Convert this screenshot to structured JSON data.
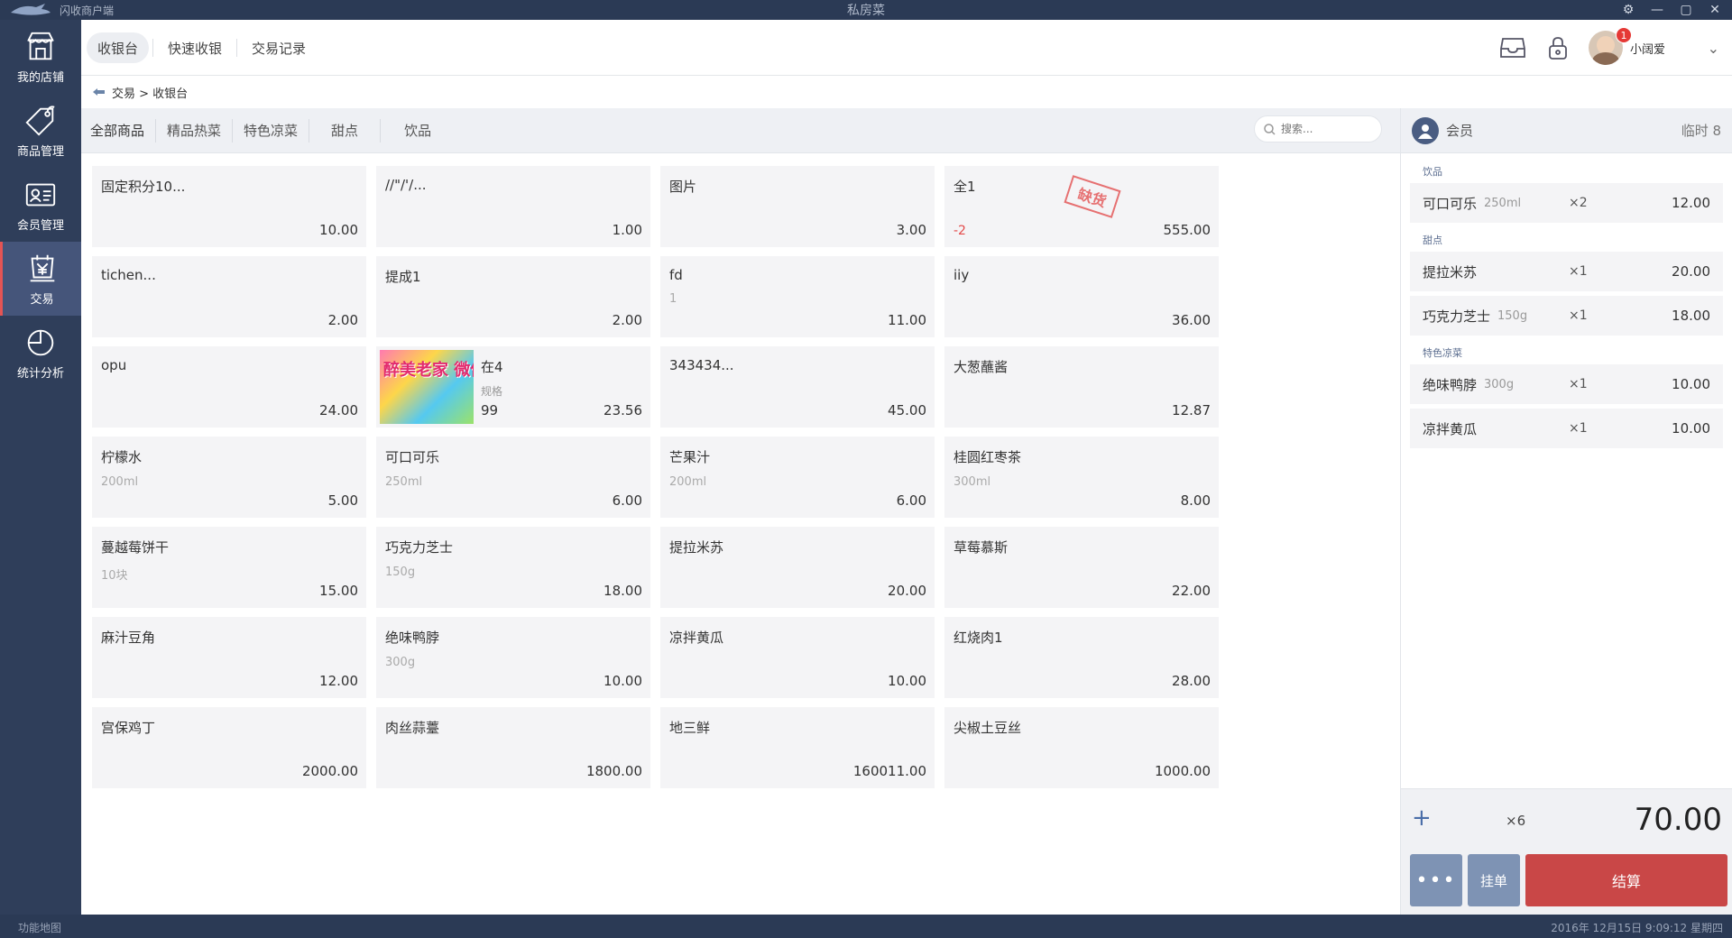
{
  "titlebar": {
    "app_name": "闪收商户端",
    "window_title": "私房菜",
    "icons": [
      "gear-icon",
      "minimize-icon",
      "maximize-icon",
      "close-icon"
    ]
  },
  "sidebar": {
    "items": [
      {
        "label": "我的店铺",
        "icon": "store-icon"
      },
      {
        "label": "商品管理",
        "icon": "tag-icon"
      },
      {
        "label": "会员管理",
        "icon": "member-card-icon"
      },
      {
        "label": "交易",
        "icon": "yen-bag-icon",
        "active": true
      },
      {
        "label": "统计分析",
        "icon": "pie-chart-icon"
      }
    ]
  },
  "toolbar": {
    "tabs": [
      {
        "label": "收银台",
        "active": true
      },
      {
        "label": "快速收银"
      },
      {
        "label": "交易记录"
      }
    ],
    "user": {
      "name": "小阔爱",
      "badge": "1"
    }
  },
  "breadcrumb": {
    "path": "交易 > 收银台"
  },
  "categories": {
    "items": [
      "全部商品",
      "精品热菜",
      "特色凉菜",
      "甜点",
      "饮品"
    ],
    "search_placeholder": "搜索..."
  },
  "products": [
    {
      "name": "固定积分10...",
      "spec": "",
      "price": "10.00"
    },
    {
      "name": "//\"/'/...",
      "spec": "",
      "price": "1.00"
    },
    {
      "name": "图片",
      "spec": "",
      "price": "3.00"
    },
    {
      "name": "全1",
      "spec": "",
      "price": "555.00",
      "stock": "-2",
      "stamp": "缺货"
    },
    {
      "name": "tichen...",
      "spec": "",
      "price": "2.00"
    },
    {
      "name": "提成1",
      "spec": "",
      "price": "2.00"
    },
    {
      "name": "fd",
      "spec": "1",
      "price": "11.00"
    },
    {
      "name": "iiy",
      "spec": "",
      "price": "36.00"
    },
    {
      "name": "opu",
      "spec": "",
      "price": "24.00"
    },
    {
      "name": "在4",
      "spec_label": "规格",
      "stock_num": "99",
      "price": "23.56",
      "image_text": "醉美老家 微信"
    },
    {
      "name": "343434...",
      "spec": "",
      "price": "45.00"
    },
    {
      "name": "大葱蘸酱",
      "spec": "",
      "price": "12.87"
    },
    {
      "name": "柠檬水",
      "spec": "200ml",
      "price": "5.00"
    },
    {
      "name": "可口可乐",
      "spec": "250ml",
      "price": "6.00"
    },
    {
      "name": "芒果汁",
      "spec": "200ml",
      "price": "6.00"
    },
    {
      "name": "桂圆红枣茶",
      "spec": "300ml",
      "price": "8.00"
    },
    {
      "name": "蔓越莓饼干",
      "spec": "10块",
      "price": "15.00"
    },
    {
      "name": "巧克力芝士",
      "spec": "150g",
      "price": "18.00"
    },
    {
      "name": "提拉米苏",
      "spec": "",
      "price": "20.00"
    },
    {
      "name": "草莓慕斯",
      "spec": "",
      "price": "22.00"
    },
    {
      "name": "麻汁豆角",
      "spec": "",
      "price": "12.00"
    },
    {
      "name": "绝味鸭脖",
      "spec": "300g",
      "price": "10.00"
    },
    {
      "name": "凉拌黄瓜",
      "spec": "",
      "price": "10.00"
    },
    {
      "name": "红烧肉1",
      "spec": "",
      "price": "28.00"
    },
    {
      "name": "宫保鸡丁",
      "spec": "",
      "price": "2000.00"
    },
    {
      "name": "肉丝蒜薹",
      "spec": "",
      "price": "1800.00"
    },
    {
      "name": "地三鲜",
      "spec": "",
      "price": "160011.00"
    },
    {
      "name": "尖椒土豆丝",
      "spec": "",
      "price": "1000.00"
    }
  ],
  "order": {
    "member_label": "会员",
    "temp_label": "临时 8",
    "groups": [
      {
        "label": "饮品",
        "items": [
          {
            "name": "可口可乐",
            "spec": "250ml",
            "qty": "×2",
            "amount": "12.00"
          }
        ]
      },
      {
        "label": "甜点",
        "items": [
          {
            "name": "提拉米苏",
            "spec": "",
            "qty": "×1",
            "amount": "20.00"
          },
          {
            "name": "巧克力芝士",
            "spec": "150g",
            "qty": "×1",
            "amount": "18.00"
          }
        ]
      },
      {
        "label": "特色凉菜",
        "items": [
          {
            "name": "绝味鸭脖",
            "spec": "300g",
            "qty": "×1",
            "amount": "10.00"
          },
          {
            "name": "凉拌黄瓜",
            "spec": "",
            "qty": "×1",
            "amount": "10.00"
          }
        ]
      }
    ],
    "total_qty": "×6",
    "total_amount": "70.00",
    "more_label": "•••",
    "hold_label": "挂单",
    "checkout_label": "结算"
  },
  "footer": {
    "func_map": "功能地图",
    "datetime": "2016年 12月15日 9:09:12 星期四"
  },
  "colors": {
    "sidebar_bg": "#2f3e5a",
    "accent_red": "#c94747",
    "action_blue": "#7e93b4"
  }
}
